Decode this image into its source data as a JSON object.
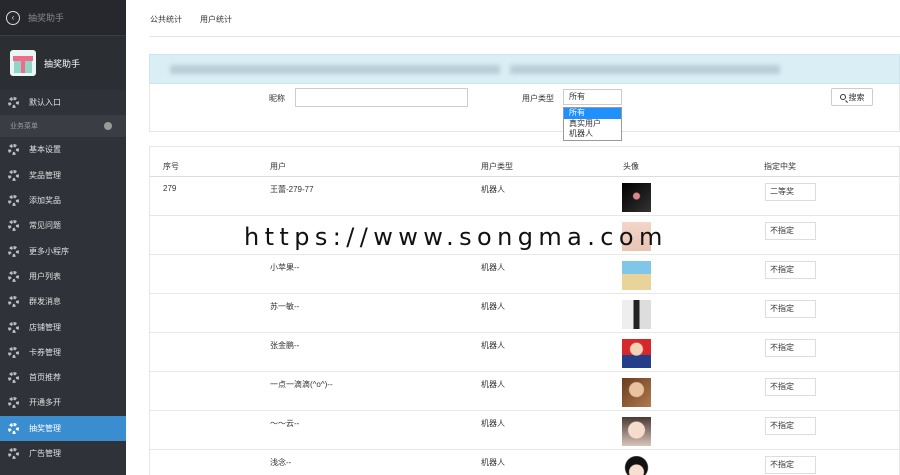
{
  "sidebar": {
    "top_title": "抽奖助手",
    "app_name": "抽奖助手",
    "items_before": [
      {
        "label": "默认入口"
      }
    ],
    "group_label": "业务菜单",
    "items": [
      {
        "label": "基本设置"
      },
      {
        "label": "奖品管理"
      },
      {
        "label": "添加奖品"
      },
      {
        "label": "常见问题"
      },
      {
        "label": "更多小程序"
      },
      {
        "label": "用户列表"
      },
      {
        "label": "群发消息"
      },
      {
        "label": "店铺管理"
      },
      {
        "label": "卡券管理"
      },
      {
        "label": "首页推荐"
      },
      {
        "label": "开通多开"
      },
      {
        "label": "抽奖管理",
        "active": true
      },
      {
        "label": "广告管理"
      }
    ]
  },
  "tabs": [
    "公共统计",
    "用户统计"
  ],
  "search": {
    "nickname_label": "昵称",
    "nickname_value": "",
    "usertype_label": "用户类型",
    "usertype_selected": "所有",
    "usertype_options": [
      "所有",
      "真实用户",
      "机器人"
    ],
    "search_button": "搜索"
  },
  "table": {
    "columns": [
      "序号",
      "用户",
      "用户类型",
      "头像",
      "指定中奖"
    ],
    "rows": [
      {
        "index": "279",
        "user": "王蕾-279-77",
        "type": "机器人",
        "choice": "二等奖",
        "avatar": "dark"
      },
      {
        "index": "",
        "user": "",
        "type": "",
        "choice": "不指定",
        "avatar": "light"
      },
      {
        "index": "",
        "user": "小苹果--",
        "type": "机器人",
        "choice": "不指定",
        "avatar": "beach"
      },
      {
        "index": "",
        "user": "苏一敏--",
        "type": "机器人",
        "choice": "不指定",
        "avatar": "bw"
      },
      {
        "index": "",
        "user": "张金鹏--",
        "type": "机器人",
        "choice": "不指定",
        "avatar": "red"
      },
      {
        "index": "",
        "user": "一点一滴滴(^o^)--",
        "type": "机器人",
        "choice": "不指定",
        "avatar": "brown"
      },
      {
        "index": "",
        "user": "～～云--",
        "type": "机器人",
        "choice": "不指定",
        "avatar": "face"
      },
      {
        "index": "",
        "user": "浅念--",
        "type": "机器人",
        "choice": "不指定",
        "avatar": "cartoon"
      }
    ]
  },
  "watermark": "https://www.songma.com"
}
